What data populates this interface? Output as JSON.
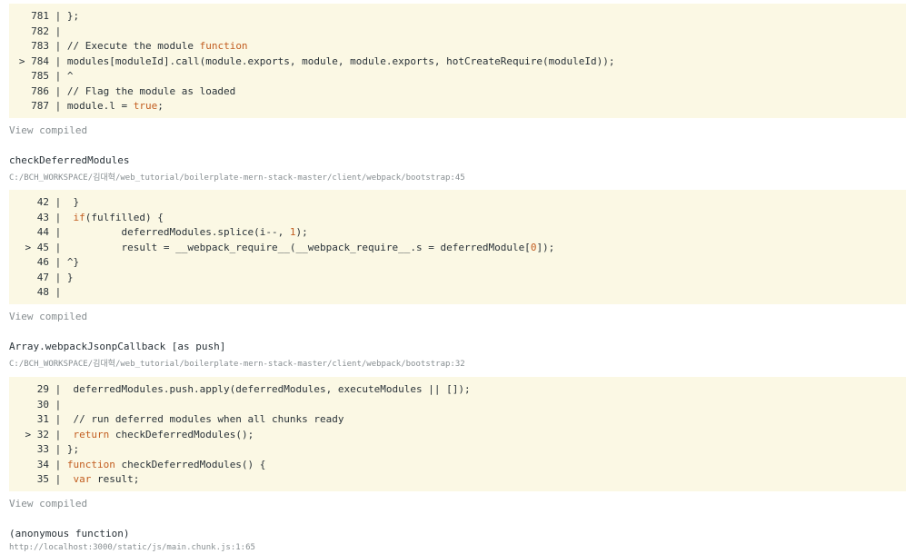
{
  "frames": [
    {
      "function": "",
      "path": "",
      "lines": [
        {
          "marker": "",
          "num": "781",
          "sep": "|",
          "code": " };"
        },
        {
          "marker": "",
          "num": "782",
          "sep": "|",
          "code": ""
        },
        {
          "marker": "",
          "num": "783",
          "sep": "|",
          "code": " // Execute the module function"
        },
        {
          "marker": ">",
          "num": "784",
          "sep": "|",
          "code": " modules[moduleId].call(module.exports, module, module.exports, hotCreateRequire(moduleId));"
        },
        {
          "marker": "",
          "num": "785",
          "sep": "|",
          "code": " ^"
        },
        {
          "marker": "",
          "num": "786",
          "sep": "|",
          "code": " // Flag the module as loaded"
        },
        {
          "marker": "",
          "num": "787",
          "sep": "|",
          "code": " module.l = true;"
        }
      ],
      "view_compiled": "View compiled"
    },
    {
      "function": "checkDeferredModules",
      "path": "C:/BCH_WORKSPACE/김대혁/web_tutorial/boilerplate-mern-stack-master/client/webpack/bootstrap:45",
      "lines": [
        {
          "marker": "",
          "num": "42",
          "sep": "|",
          "code": "  }"
        },
        {
          "marker": "",
          "num": "43",
          "sep": "|",
          "code": "  if(fulfilled) {"
        },
        {
          "marker": "",
          "num": "44",
          "sep": "|",
          "code": "          deferredModules.splice(i--, 1);"
        },
        {
          "marker": ">",
          "num": "45",
          "sep": "|",
          "code": "          result = __webpack_require__(__webpack_require__.s = deferredModule[0]);"
        },
        {
          "marker": "",
          "num": "46",
          "sep": "|",
          "code": " ^}"
        },
        {
          "marker": "",
          "num": "47",
          "sep": "|",
          "code": " }"
        },
        {
          "marker": "",
          "num": "48",
          "sep": "|",
          "code": ""
        }
      ],
      "view_compiled": "View compiled"
    },
    {
      "function": "Array.webpackJsonpCallback [as push]",
      "path": "C:/BCH_WORKSPACE/김대혁/web_tutorial/boilerplate-mern-stack-master/client/webpack/bootstrap:32",
      "lines": [
        {
          "marker": "",
          "num": "29",
          "sep": "|",
          "code": "  deferredModules.push.apply(deferredModules, executeModules || []);"
        },
        {
          "marker": "",
          "num": "30",
          "sep": "|",
          "code": ""
        },
        {
          "marker": "",
          "num": "31",
          "sep": "|",
          "code": "  // run deferred modules when all chunks ready"
        },
        {
          "marker": ">",
          "num": "32",
          "sep": "|",
          "code": "  return checkDeferredModules();"
        },
        {
          "marker": "",
          "num": "33",
          "sep": "|",
          "code": " };"
        },
        {
          "marker": "",
          "num": "34",
          "sep": "|",
          "code": " function checkDeferredModules() {"
        },
        {
          "marker": "",
          "num": "35",
          "sep": "|",
          "code": "  var result;"
        }
      ],
      "view_compiled": "View compiled"
    },
    {
      "function": "(anonymous function)",
      "path": "http://localhost:3000/static/js/main.chunk.js:1:65"
    }
  ],
  "colors": {
    "code_bg": "#fbf8e4",
    "muted": "#878e91",
    "keyword": "#c25d20"
  }
}
